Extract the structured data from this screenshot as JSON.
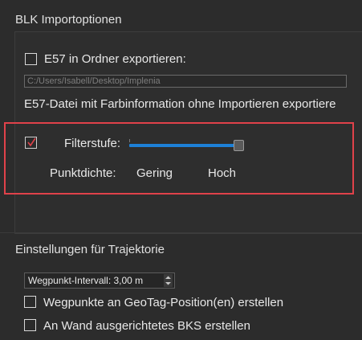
{
  "blk": {
    "title": "BLK Importoptionen",
    "e57_export_label": "E57 in Ordner exportieren:",
    "e57_export_checked": false,
    "path_value": "C:/Users/Isabell/Desktop/Implenia",
    "color_info_text": "E57-Datei mit Farbinformation ohne Importieren exportiere",
    "filter": {
      "checked": true,
      "label": "Filterstufe:",
      "level": 1.0
    },
    "density": {
      "label": "Punktdichte:",
      "low": "Gering",
      "high": "Hoch"
    }
  },
  "trajectory": {
    "title": "Einstellungen für Trajektorie",
    "waypoint_interval": "Wegpunkt-Intervall: 3,00 m",
    "geotag_label": "Wegpunkte an GeoTag-Position(en) erstellen",
    "geotag_checked": false,
    "wall_ucs_label": "An Wand ausgerichtetes BKS erstellen",
    "wall_ucs_checked": false
  },
  "colors": {
    "highlight": "#e0424a",
    "slider": "#1d80d7",
    "checkmark": "#e0424a"
  }
}
